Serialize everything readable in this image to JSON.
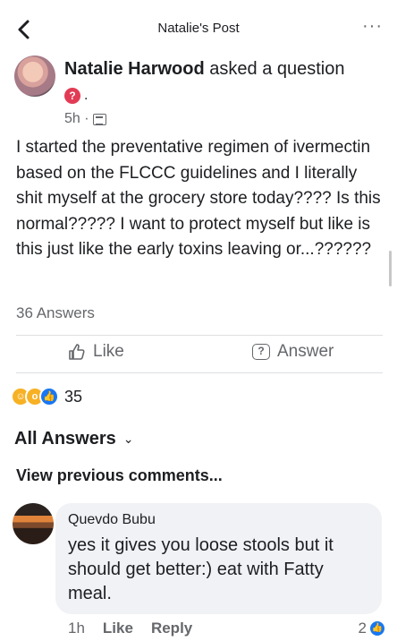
{
  "header": {
    "title": "Natalie's Post",
    "more": "···"
  },
  "post": {
    "author": "Natalie Harwood",
    "action": "asked a question",
    "badge": "?",
    "time": "5h ·",
    "body": "I started the preventative regimen of ivermectin based on the FLCCC guidelines and I literally shit myself at the grocery store today???? Is this normal????? I want to protect myself but like is this just like the early toxins leaving or...??????",
    "answers_count": "36 Answers"
  },
  "actions": {
    "like": "Like",
    "answer": "Answer"
  },
  "reactions": {
    "count": "35"
  },
  "answers_section": {
    "title": "All Answers",
    "view_previous": "View previous comments..."
  },
  "comment": {
    "author": "Quevdo Bubu",
    "text": "yes it gives you loose stools but it should get better:)    eat with Fatty meal.",
    "time": "1h",
    "like": "Like",
    "reply": "Reply",
    "reaction_count": "2"
  },
  "colors": {
    "accent": "#1877f2",
    "question_badge": "#e23b55",
    "muted": "#65676b"
  }
}
